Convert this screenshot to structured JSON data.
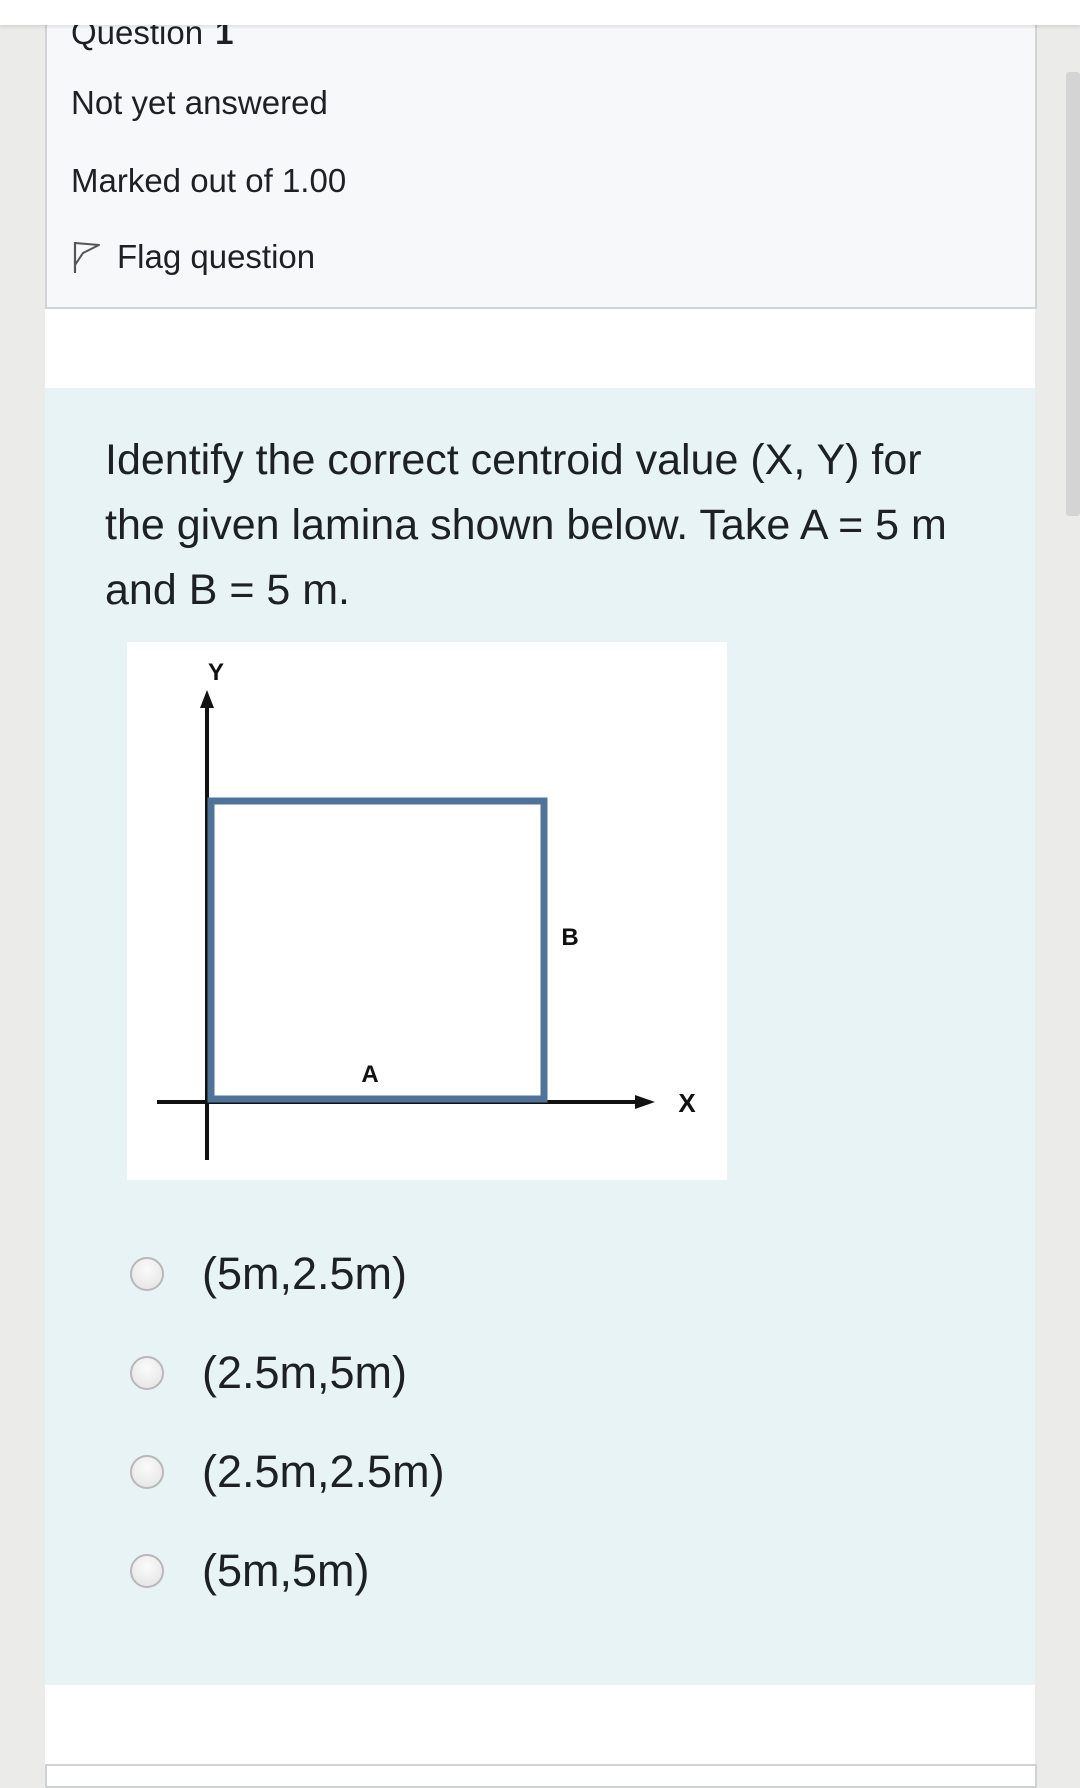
{
  "question_info": {
    "label": "Question",
    "number": "1",
    "status": "Not yet answered",
    "marks": "Marked out of 1.00",
    "flag_label": "Flag question"
  },
  "question": {
    "text": "Identify the correct centroid value (X, Y) for the given lamina shown below. Take A = 5 m and B = 5 m.",
    "diagram": {
      "y_axis_label": "Y",
      "x_axis_label": "X",
      "side_a_label": "A",
      "side_b_label": "B",
      "shape_color": "#4f7399"
    },
    "options": [
      {
        "label": "(5m,2.5m)",
        "selected": false
      },
      {
        "label": "(2.5m,5m)",
        "selected": false
      },
      {
        "label": "(2.5m,2.5m)",
        "selected": false
      },
      {
        "label": "(5m,5m)",
        "selected": false
      }
    ]
  },
  "colors": {
    "info_background": "#f7f8fa",
    "formulation_background": "#e7f3f5",
    "text": "#1d2125"
  }
}
